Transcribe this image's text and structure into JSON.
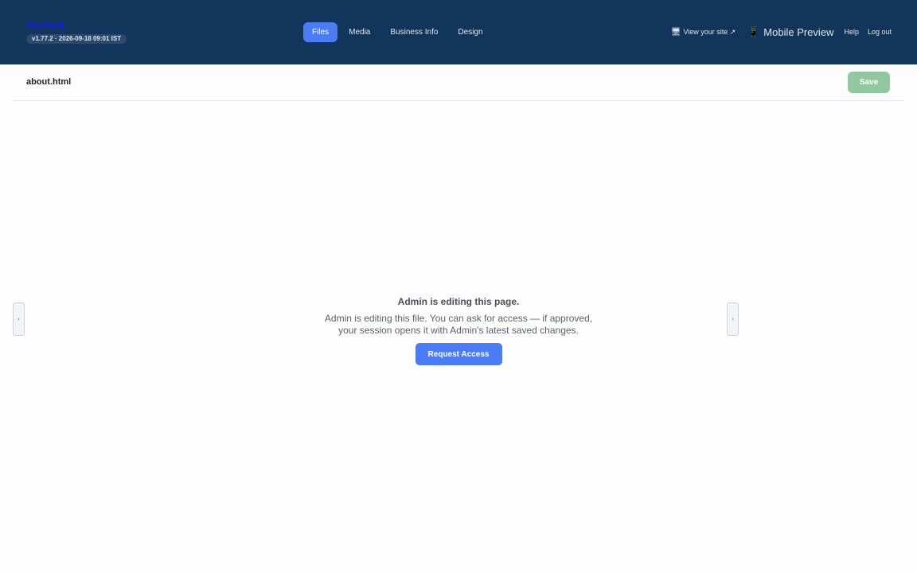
{
  "brand": {
    "name": "GeoRank",
    "version": "v1.77.2 · 2026-09-18 09:01 IST"
  },
  "nav": {
    "tabs": [
      {
        "label": "Files",
        "active": true
      },
      {
        "label": "Media",
        "active": false
      },
      {
        "label": "Business Info",
        "active": false
      },
      {
        "label": "Design",
        "active": false
      }
    ]
  },
  "right_nav": {
    "view_site": {
      "icon": "monitor-icon",
      "glyph": "🖥",
      "label": "View your site ↗"
    },
    "mobile_preview": {
      "icon": "phone-icon",
      "glyph": "📱",
      "label": "Mobile Preview"
    },
    "help": "Help",
    "logout": "Log out"
  },
  "editor": {
    "filename": "about.html",
    "save_label": "Save",
    "left_handle": "›",
    "right_handle": "›"
  },
  "lock_notice": {
    "title": "Admin is editing this page.",
    "message": "Admin is editing this file. You can ask for access — if approved, your session opens it with Admin's latest saved changes.",
    "button_label": "Request Access"
  },
  "colors": {
    "topbar": "#12355b",
    "accent": "#4c7cf4",
    "save_disabled": "#92c8a0"
  }
}
